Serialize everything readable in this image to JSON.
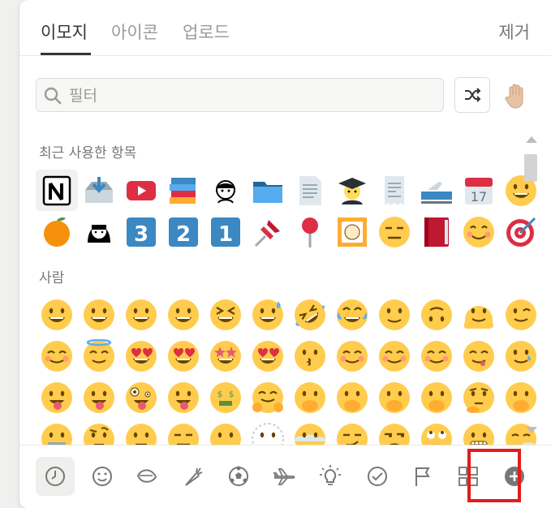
{
  "tabs": [
    {
      "label": "이모지",
      "active": true
    },
    {
      "label": "아이콘",
      "active": false
    },
    {
      "label": "업로드",
      "active": false
    }
  ],
  "remove_label": "제거",
  "search": {
    "placeholder": "필터",
    "value": ""
  },
  "sections": [
    {
      "title": "최근 사용한 항목",
      "emojis": [
        "notion-logo",
        "inbox-tray",
        "youtube",
        "books",
        "avatar-sketch",
        "file-folder",
        "page-facing-up",
        "student",
        "receipt",
        "railway-car",
        "calendar",
        "grinning-face",
        "tangerine",
        "avatar-girl",
        "keycap-3",
        "keycap-2",
        "keycap-1",
        "pushpin",
        "round-pushpin",
        "framed-picture",
        "expressionless",
        "closed-book",
        "smiling-blush",
        "direct-hit"
      ]
    },
    {
      "title": "사람",
      "emojis": [
        "grinning",
        "smiley",
        "grin",
        "beaming",
        "squinting",
        "sweat-smile",
        "rofl",
        "joy",
        "slight-smile",
        "upside-down",
        "melting",
        "wink",
        "blush",
        "innocent",
        "hearts-face",
        "heart-eyes",
        "star-struck",
        "kissing-heart",
        "kissing",
        "relaxed",
        "kissing-closed",
        "kissing-smiling",
        "yum",
        "smiling-tear",
        "tongue",
        "tongue-wink",
        "zany",
        "squint-tongue",
        "money-mouth",
        "hugging",
        "hand-over-mouth",
        "open-eyes-hand",
        "peeking",
        "shushing",
        "thinking",
        "saluting",
        "zipper",
        "raised-eyebrow",
        "neutral",
        "expressionless2",
        "no-mouth",
        "dotted-line",
        "face-in-clouds",
        "smirk",
        "unamused",
        "eye-roll",
        "grimacing",
        "exhale"
      ]
    }
  ],
  "categories": [
    {
      "name": "recent",
      "icon": "clock-icon",
      "active": true
    },
    {
      "name": "people",
      "icon": "smiley-icon"
    },
    {
      "name": "nature",
      "icon": "leaf-icon"
    },
    {
      "name": "food",
      "icon": "carrot-icon"
    },
    {
      "name": "activity",
      "icon": "soccer-ball-icon"
    },
    {
      "name": "travel",
      "icon": "airplane-icon"
    },
    {
      "name": "objects",
      "icon": "lightbulb-icon"
    },
    {
      "name": "symbols",
      "icon": "check-circle-icon"
    },
    {
      "name": "flags",
      "icon": "flag-icon"
    },
    {
      "name": "custom",
      "icon": "grid-icon"
    },
    {
      "name": "add",
      "icon": "plus-circle-icon"
    }
  ],
  "colors": {
    "accent_highlight": "#e21c1c",
    "text": "#37352f",
    "muted": "#9b9a97",
    "emoji_yellow": "#ffcc4d"
  }
}
